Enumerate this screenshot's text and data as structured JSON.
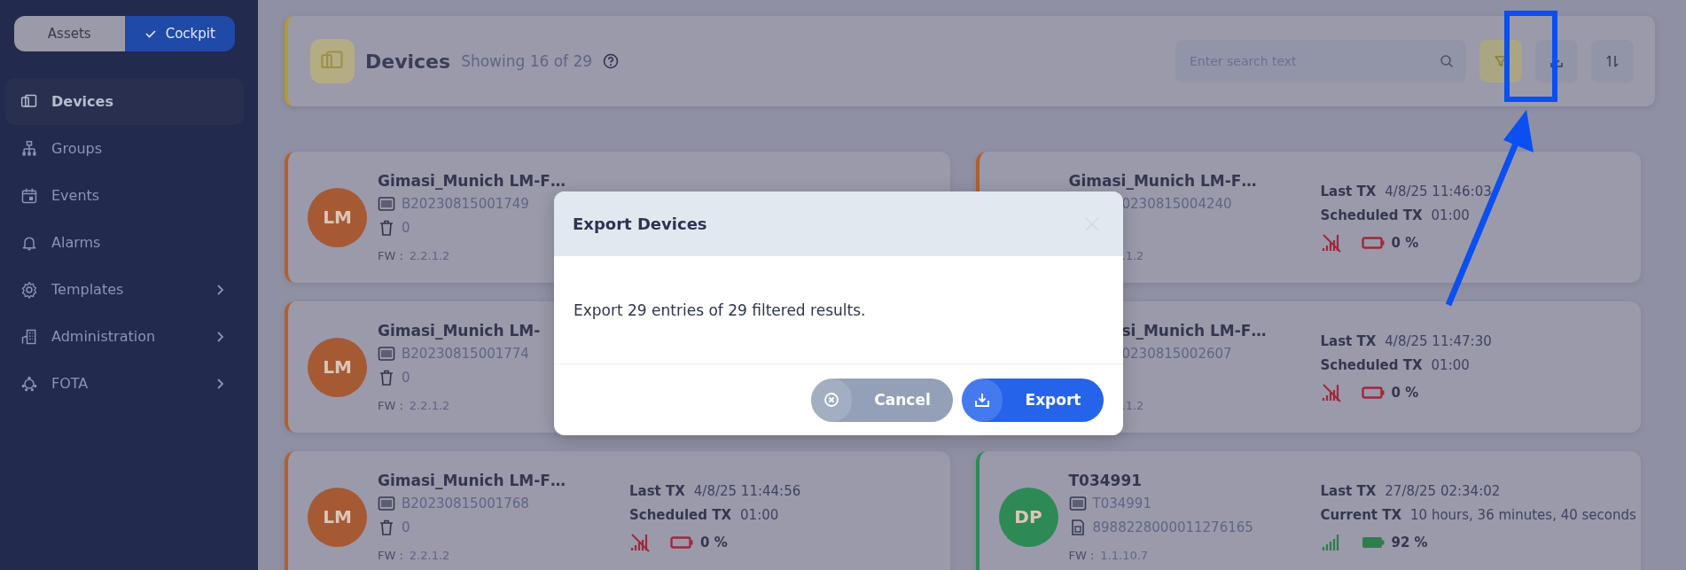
{
  "sidebar": {
    "mode_toggle": [
      {
        "label": "Assets",
        "selected": false
      },
      {
        "label": "Cockpit",
        "selected": true
      }
    ],
    "items": [
      {
        "label": "Devices",
        "selected": true,
        "expandable": false
      },
      {
        "label": "Groups",
        "selected": false,
        "expandable": false
      },
      {
        "label": "Events",
        "selected": false,
        "expandable": false
      },
      {
        "label": "Alarms",
        "selected": false,
        "expandable": false
      },
      {
        "label": "Templates",
        "selected": false,
        "expandable": true
      },
      {
        "label": "Administration",
        "selected": false,
        "expandable": true
      },
      {
        "label": "FOTA",
        "selected": false,
        "expandable": true
      }
    ]
  },
  "header": {
    "title": "Devices",
    "subtitle": "Showing 16 of 29",
    "search": {
      "placeholder": "Enter search text"
    },
    "buttons": [
      {
        "kind": "filter",
        "active": true
      },
      {
        "kind": "export",
        "active": false
      },
      {
        "kind": "sort",
        "active": false
      }
    ]
  },
  "cards": [
    {
      "avatar": "LM",
      "color": "#a55a34",
      "name": "Gimasi_Munich LM-F…",
      "name_cut": false,
      "lines": [
        {
          "kind": "serial",
          "text": "B20230815001749",
          "cut": false
        },
        {
          "kind": "trash",
          "text": "0",
          "cut": false
        },
        {
          "kind": "fw",
          "label": "FW :",
          "text": "2.2.1.2",
          "cut": false
        }
      ]
    },
    {
      "name": "Gimasi_Munich LM-F…",
      "name_cut": false,
      "lines": [
        {
          "kind": "serial",
          "text": "0230815004240",
          "cut": true
        },
        {
          "kind": "fw",
          "text": ".1.2",
          "cut": true
        }
      ],
      "stats": [
        {
          "label": "Last TX",
          "value": "4/8/25 11:46:03"
        },
        {
          "label": "Scheduled TX",
          "value": "01:00"
        }
      ],
      "connected": false,
      "battery_low": true,
      "battery_text": "0 %"
    },
    {
      "avatar": "LM",
      "color": "#a55a34",
      "name": "Gimasi_Munich LM-",
      "name_cut": false,
      "lines": [
        {
          "kind": "serial",
          "text": "B20230815001774",
          "cut": false
        },
        {
          "kind": "trash",
          "text": "0",
          "cut": false
        },
        {
          "kind": "fw",
          "label": "FW :",
          "text": "2.2.1.2",
          "cut": false
        }
      ]
    },
    {
      "name": "si_Munich LM-F…",
      "name_cut": true,
      "lines": [
        {
          "kind": "serial",
          "text": "0230815002607",
          "cut": true
        },
        {
          "kind": "fw",
          "text": ".1.2",
          "cut": true
        }
      ],
      "stats": [
        {
          "label": "Last TX",
          "value": "4/8/25 11:47:30"
        },
        {
          "label": "Scheduled TX",
          "value": "01:00"
        }
      ],
      "connected": false,
      "battery_low": true,
      "battery_text": "0 %"
    },
    {
      "avatar": "LM",
      "color": "#a55a34",
      "name": "Gimasi_Munich LM-F…",
      "name_cut": false,
      "lines": [
        {
          "kind": "serial",
          "text": "B20230815001768",
          "cut": false
        },
        {
          "kind": "trash",
          "text": "0",
          "cut": false
        },
        {
          "kind": "fw",
          "label": "FW :",
          "text": "2.2.1.2",
          "cut": false
        }
      ],
      "stats": [
        {
          "label": "Last TX",
          "value": "4/8/25 11:44:56"
        },
        {
          "label": "Scheduled TX",
          "value": "01:00"
        }
      ],
      "connected": false,
      "battery_low": true,
      "battery_text": "0 %"
    },
    {
      "avatar": "DP",
      "color": "#2e8a55",
      "name": "T034991",
      "name_cut": false,
      "lines": [
        {
          "kind": "serial",
          "text": "T034991",
          "cut": false
        },
        {
          "kind": "sim",
          "text": "8988228000011276165",
          "cut": false
        },
        {
          "kind": "fw",
          "label": "FW :",
          "text": "1.1.10.7",
          "cut": false
        }
      ],
      "stats": [
        {
          "label": "Last TX",
          "value": "27/8/25 02:34:02"
        },
        {
          "label": "Current TX",
          "value": "10 hours, 36 minutes, 40 seconds"
        }
      ],
      "connected": true,
      "battery_low": false,
      "battery_text": "92 %"
    }
  ],
  "dialog": {
    "title": "Export Devices",
    "message": "Export 29 entries of 29 filtered results.",
    "buttons": [
      {
        "kind": "cancel",
        "label": "Cancel"
      },
      {
        "kind": "export",
        "label": "Export"
      }
    ]
  }
}
